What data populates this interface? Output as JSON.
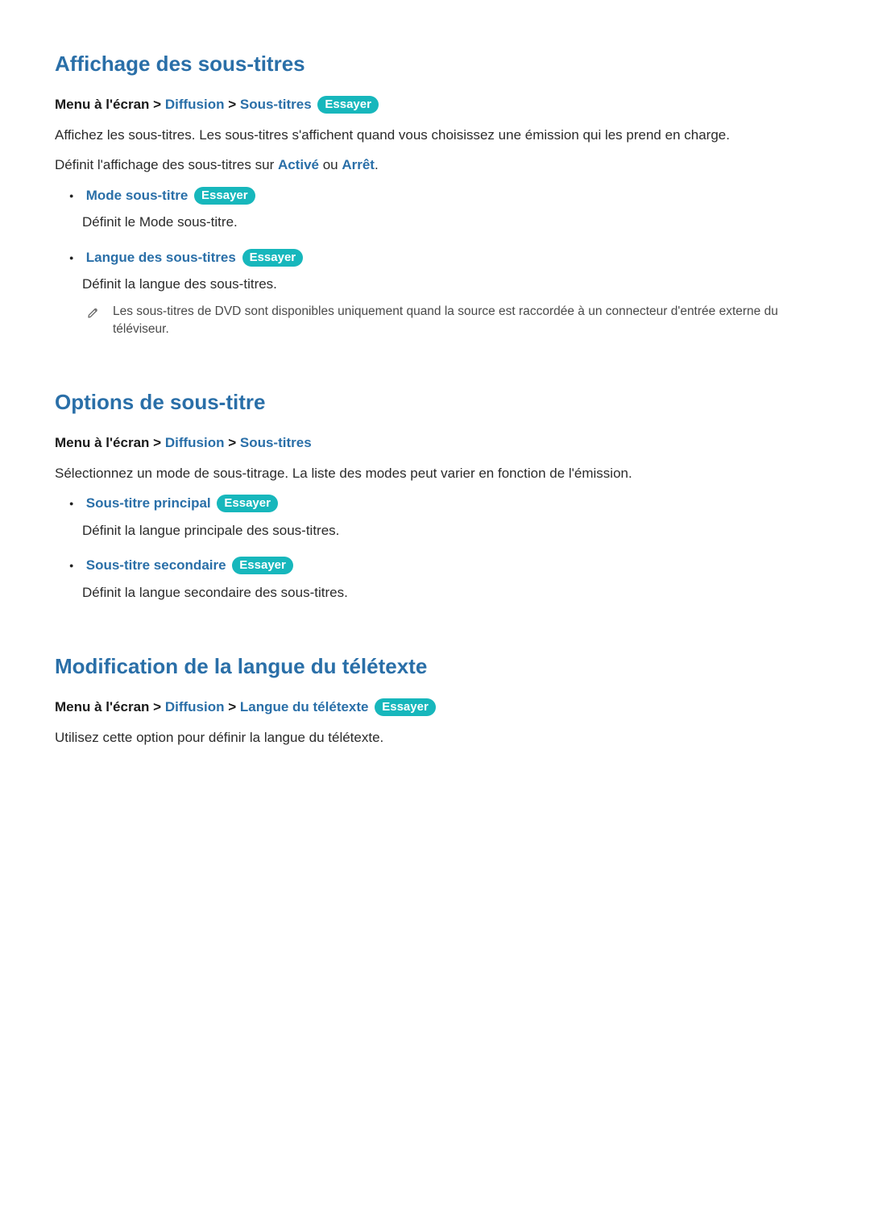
{
  "try_label": "Essayer",
  "section1": {
    "title": "Affichage des sous-titres",
    "breadcrumb": {
      "root": "Menu à l'écran",
      "p1": "Diffusion",
      "p2": "Sous-titres"
    },
    "paragraph1": "Affichez les sous-titres. Les sous-titres s'affichent quand vous choisissez une émission qui les prend en charge.",
    "paragraph2_pre": "Définit l'affichage des sous-titres sur ",
    "paragraph2_on": "Activé",
    "paragraph2_mid": " ou ",
    "paragraph2_off": "Arrêt",
    "paragraph2_post": ".",
    "items": [
      {
        "title": "Mode sous-titre",
        "desc": "Définit le Mode sous-titre."
      },
      {
        "title": "Langue des sous-titres",
        "desc": "Définit la langue des sous-titres."
      }
    ],
    "note": "Les sous-titres de DVD sont disponibles uniquement quand la source est raccordée à un connecteur d'entrée externe du téléviseur."
  },
  "section2": {
    "title": "Options de sous-titre",
    "breadcrumb": {
      "root": "Menu à l'écran",
      "p1": "Diffusion",
      "p2": "Sous-titres"
    },
    "paragraph": "Sélectionnez un mode de sous-titrage. La liste des modes peut varier en fonction de l'émission.",
    "items": [
      {
        "title": "Sous-titre principal",
        "desc": "Définit la langue principale des sous-titres."
      },
      {
        "title": "Sous-titre secondaire",
        "desc": "Définit la langue secondaire des sous-titres."
      }
    ]
  },
  "section3": {
    "title": "Modification de la langue du télétexte",
    "breadcrumb": {
      "root": "Menu à l'écran",
      "p1": "Diffusion",
      "p2": "Langue du télétexte"
    },
    "paragraph": "Utilisez cette option pour définir la langue du télétexte."
  }
}
